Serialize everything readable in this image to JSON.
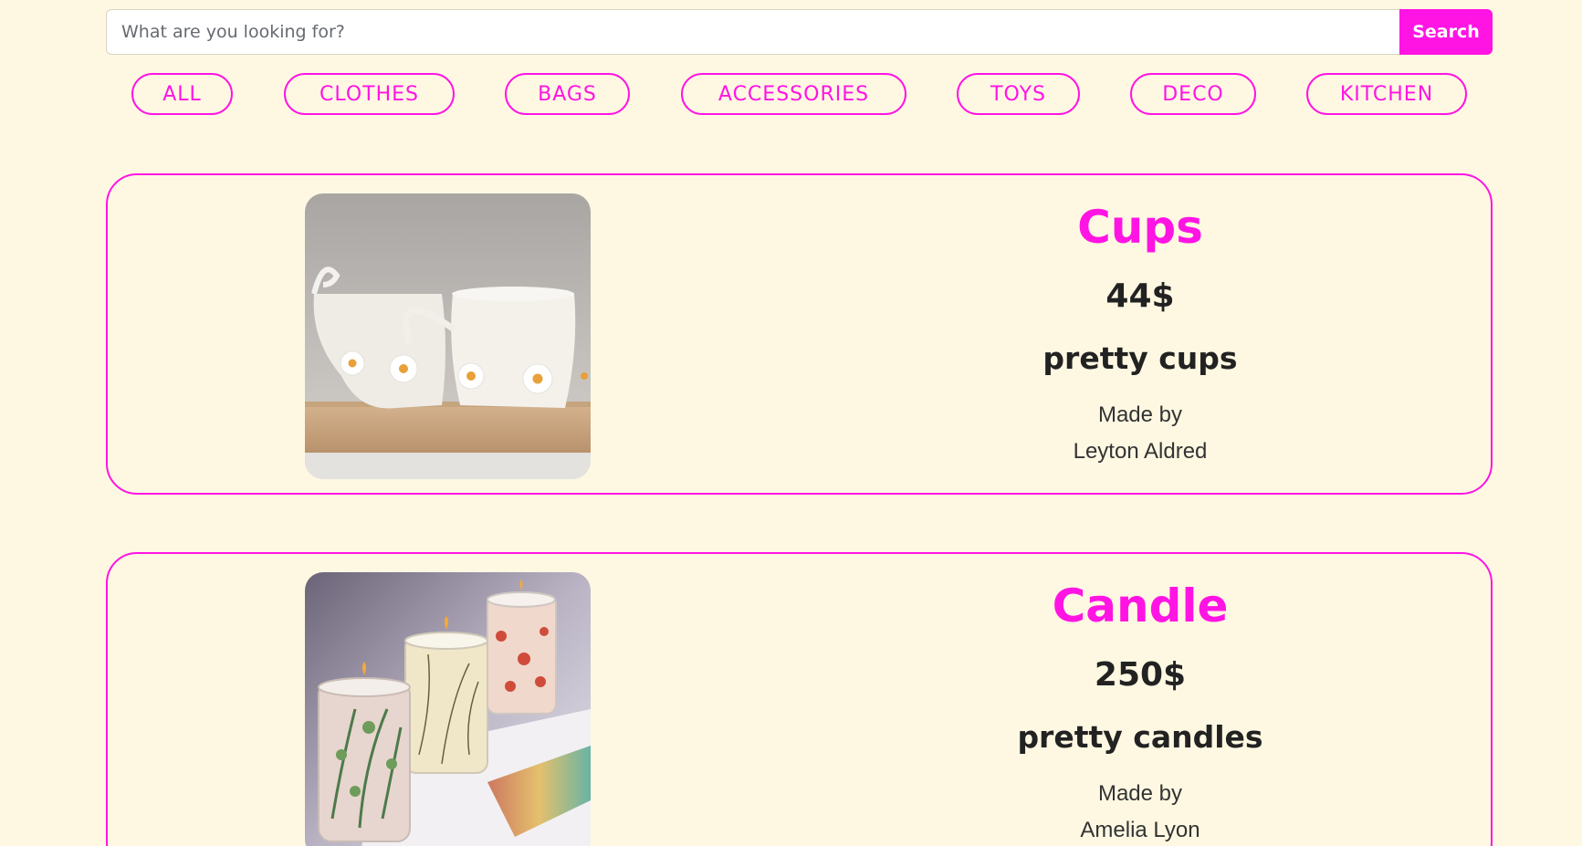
{
  "search": {
    "placeholder": "What are you looking for?",
    "button_label": "Search"
  },
  "categories": [
    "ALL",
    "CLOTHES",
    "BAGS",
    "ACCESSORIES",
    "TOYS",
    "DECO",
    "KITCHEN"
  ],
  "products": [
    {
      "title": "Cups",
      "price": "44$",
      "description": "pretty cups",
      "made_by_label": "Made by",
      "maker": "Leyton Aldred",
      "image": "white-daisy-mugs-photo"
    },
    {
      "title": "Candle",
      "price": "250$",
      "description": "pretty candles",
      "made_by_label": "Made by",
      "maker": "Amelia Lyon",
      "image": "botanical-candle-jars-photo"
    }
  ],
  "colors": {
    "accent": "#ff14e4",
    "background": "#fef8e2",
    "text": "#222222"
  }
}
